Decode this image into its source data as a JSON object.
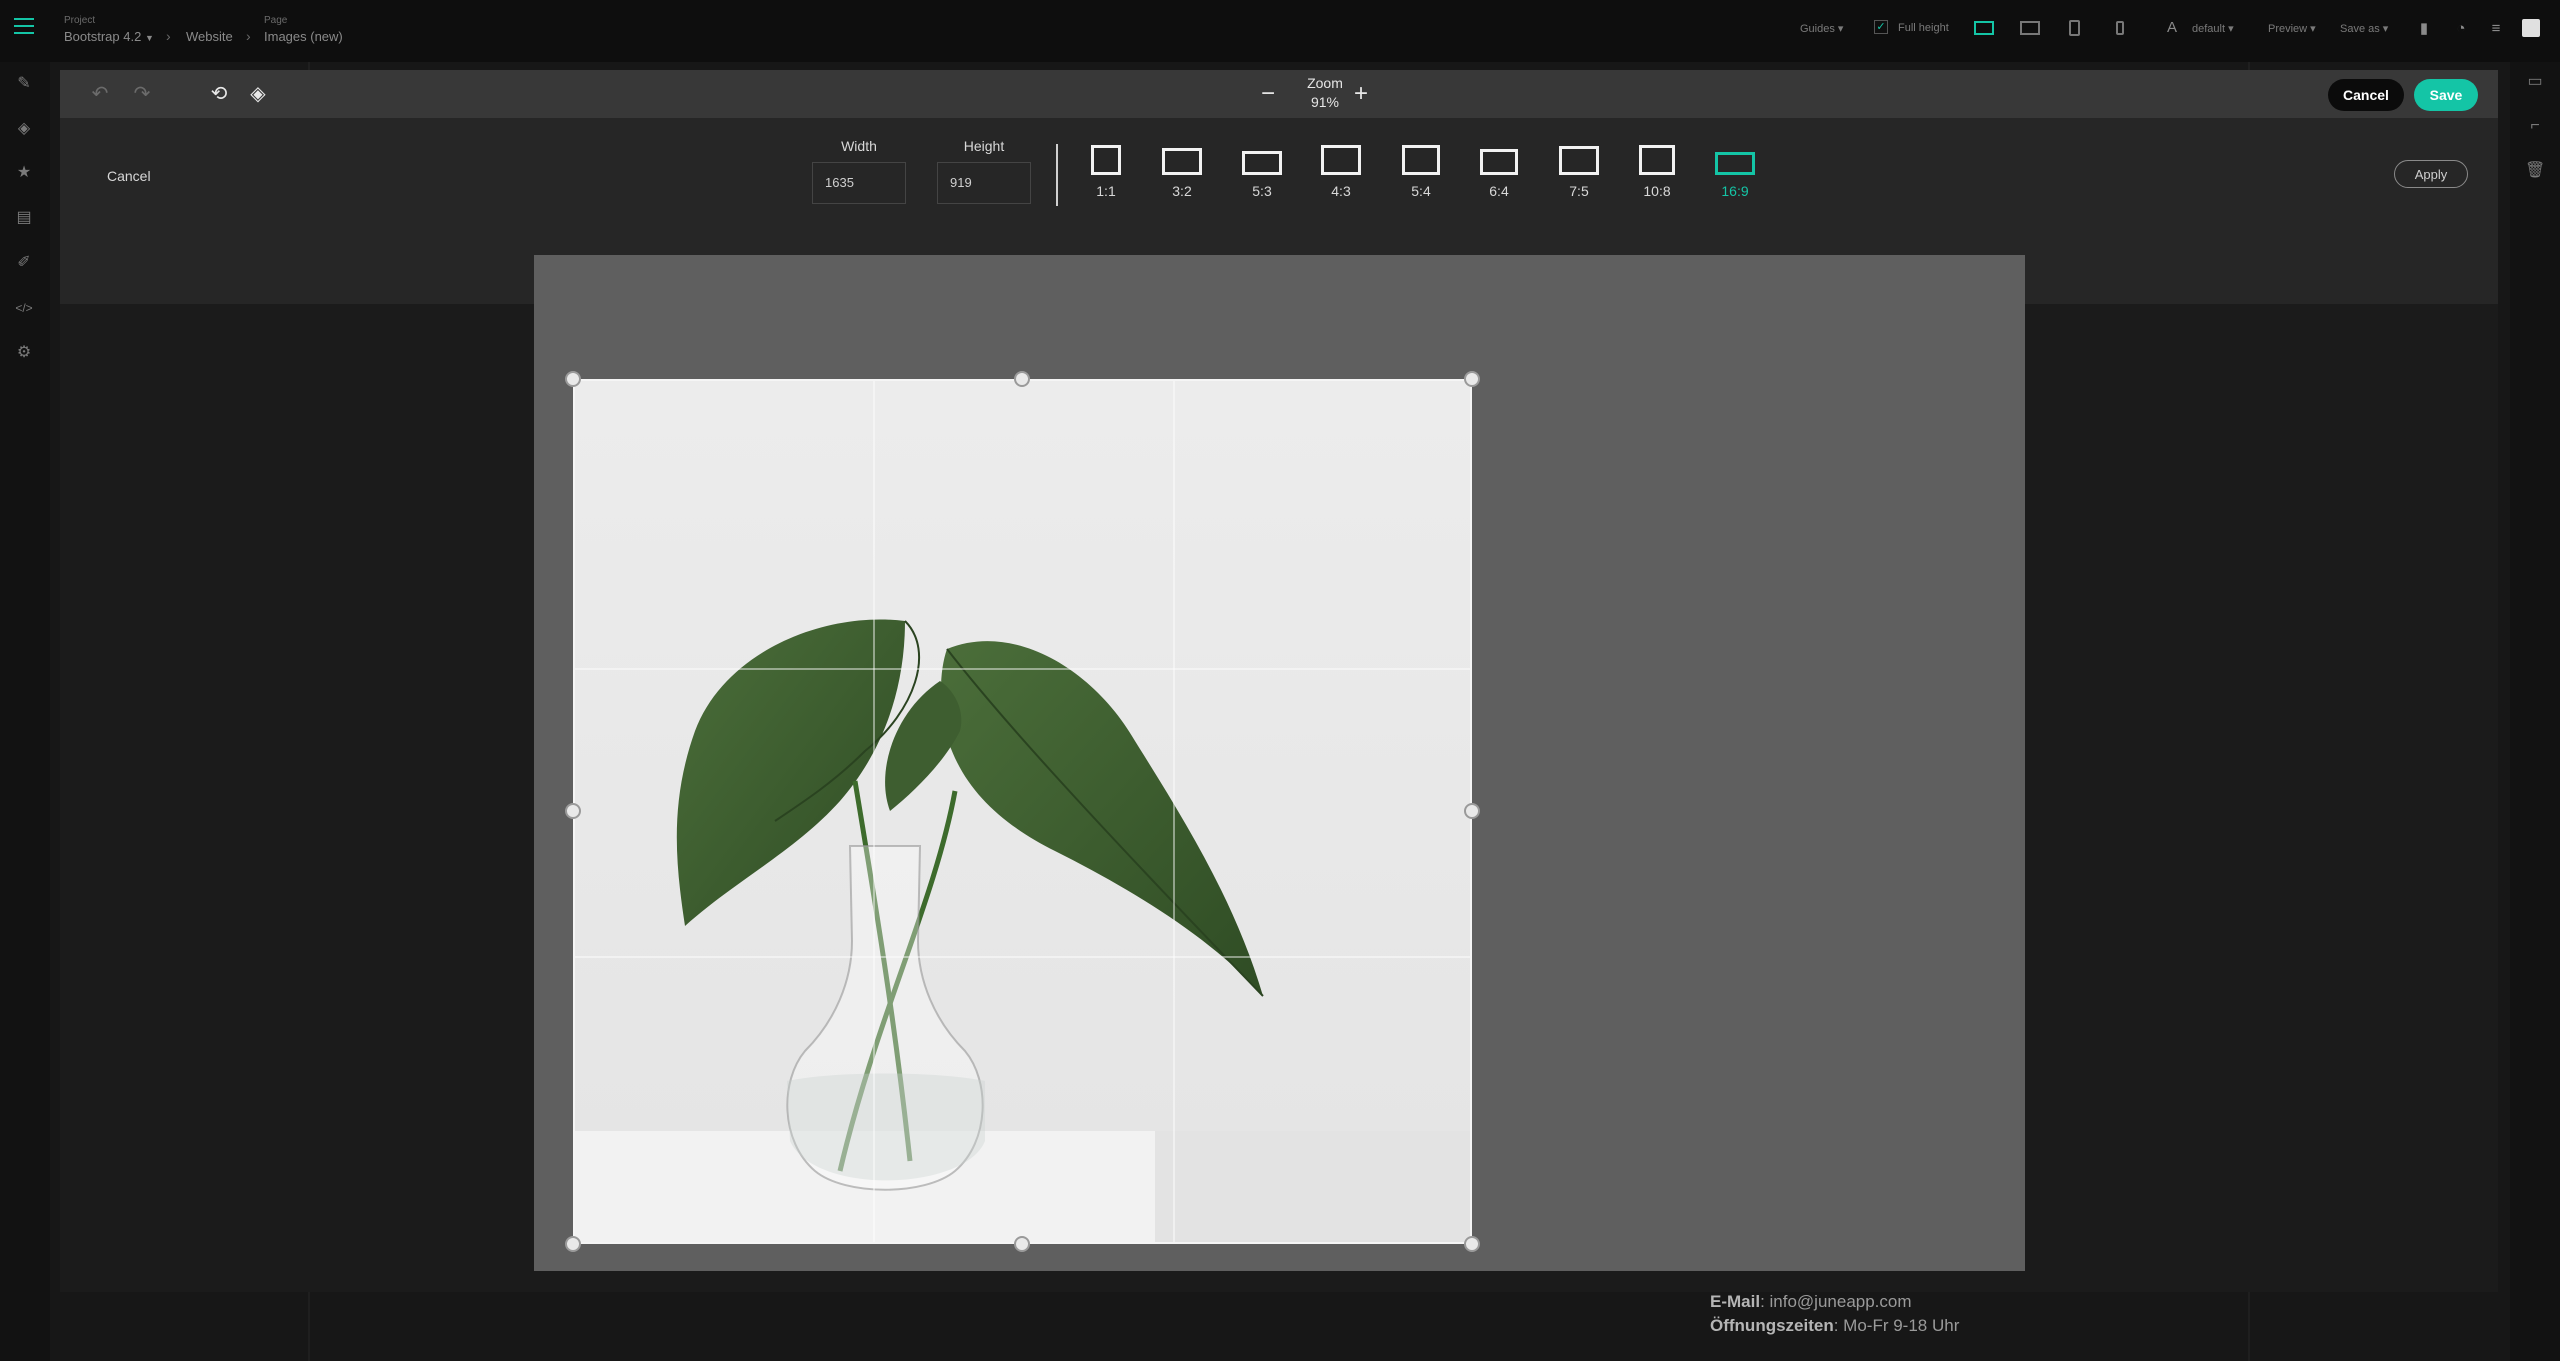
{
  "topbar": {
    "project_label": "Project",
    "project_value": "Bootstrap 4.2",
    "website_label": "Website",
    "page_label": "Page",
    "page_value": "Images (new)",
    "guides": "Guides",
    "full_height": "Full height",
    "font_default": "default",
    "preview": "Preview",
    "save_as": "Save as"
  },
  "modal": {
    "zoom_label": "Zoom",
    "zoom_value": "91%",
    "cancel": "Cancel",
    "save": "Save",
    "toolbar_cancel": "Cancel",
    "width_label": "Width",
    "width_value": "1635",
    "height_label": "Height",
    "height_value": "919",
    "apply": "Apply",
    "ratios": [
      "1:1",
      "3:2",
      "5:3",
      "4:3",
      "5:4",
      "6:4",
      "7:5",
      "10:8",
      "16:9"
    ],
    "active_ratio": "16:9"
  },
  "footer": {
    "email_label": "E-Mail",
    "email_value": ": info@juneapp.com",
    "hours_label": "Öffnungszeiten",
    "hours_value": ": Mo-Fr 9-18 Uhr"
  },
  "colors": {
    "accent": "#14c5a6",
    "header": "#383838",
    "toolbar": "#262626",
    "crop_mask": "#616161"
  }
}
